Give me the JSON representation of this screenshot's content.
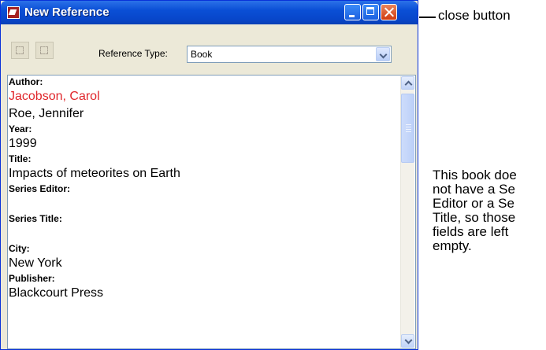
{
  "window": {
    "title": "New Reference",
    "icon": "app-icon",
    "controls": [
      "minimize-icon",
      "maximize-icon",
      "close-icon"
    ]
  },
  "toolbar": {
    "buttons": [
      "insert-icon",
      "remove-icon"
    ],
    "reference_type_label": "Reference Type:",
    "reference_type_value": "Book"
  },
  "fields": {
    "author_label": "Author:",
    "authors": [
      "Jacobson, Carol",
      "Roe, Jennifer"
    ],
    "year_label": "Year:",
    "year_value": "1999",
    "title_label": "Title:",
    "title_value": "Impacts of meteorites on Earth",
    "series_editor_label": "Series Editor:",
    "series_editor_value": "",
    "series_title_label": "Series Title:",
    "series_title_value": "",
    "city_label": "City:",
    "city_value": "New York",
    "publisher_label": "Publisher:",
    "publisher_value": "Blackcourt Press"
  },
  "annotations": {
    "close_callout": "close button",
    "note": "This book doe\nnot have a Se\nEditor or a Se\nTitle, so those\nfields are left\nempty."
  },
  "colors": {
    "titlebar": "#0a4fd6",
    "highlight_author": "#e0262b",
    "window_bg": "#ece9d8"
  }
}
